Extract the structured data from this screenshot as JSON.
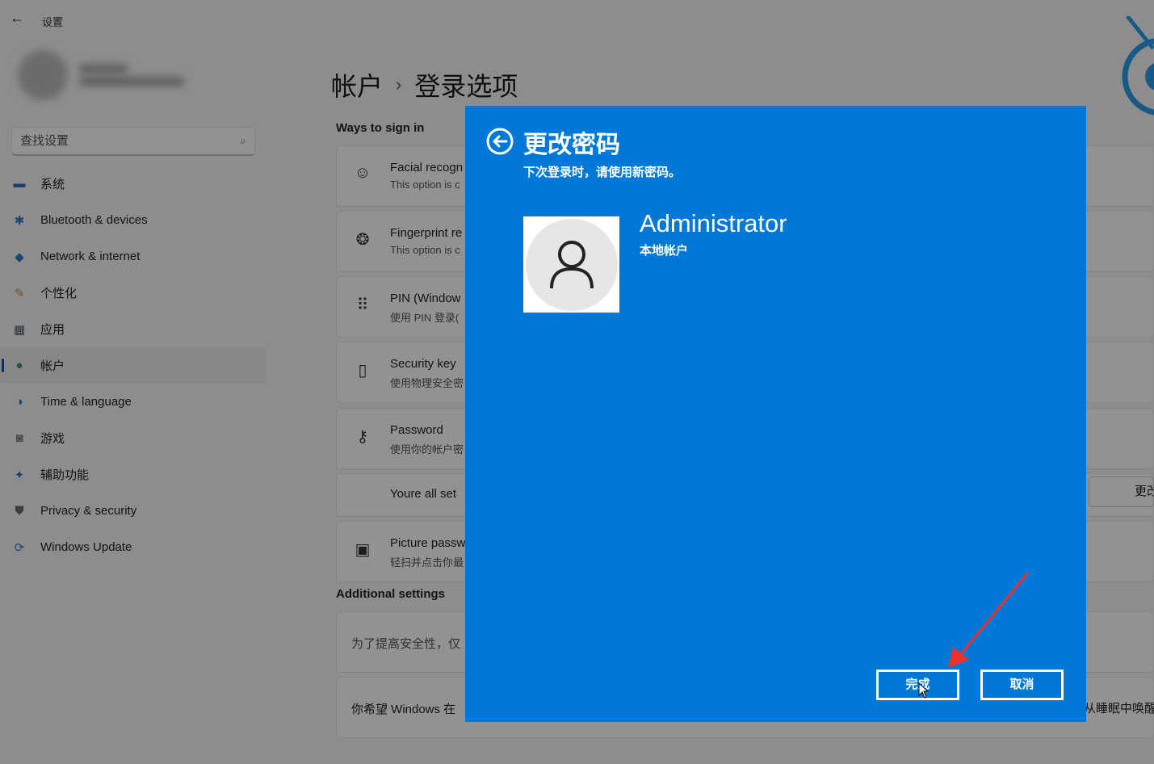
{
  "window": {
    "back_glyph": "←",
    "title": "设置"
  },
  "search": {
    "placeholder": "查找设置"
  },
  "nav": {
    "items": [
      {
        "label": "系统",
        "icon": "monitor-icon",
        "glyph": "▬",
        "color": "#2b79c2"
      },
      {
        "label": "Bluetooth & devices",
        "icon": "bluetooth-icon",
        "glyph": "✱",
        "color": "#2b79c2"
      },
      {
        "label": "Network & internet",
        "icon": "wifi-icon",
        "glyph": "◆",
        "color": "#2b79c2"
      },
      {
        "label": "个性化",
        "icon": "brush-icon",
        "glyph": "✎",
        "color": "#d08a3a"
      },
      {
        "label": "应用",
        "icon": "apps-icon",
        "glyph": "▦",
        "color": "#4b5a6b"
      },
      {
        "label": "帐户",
        "icon": "person-icon",
        "glyph": "●",
        "color": "#27a25b",
        "active": true
      },
      {
        "label": "Time & language",
        "icon": "globe-icon",
        "glyph": "◑",
        "color": "#2b79c2"
      },
      {
        "label": "游戏",
        "icon": "gamepad-icon",
        "glyph": "◙",
        "color": "#777777"
      },
      {
        "label": "辅助功能",
        "icon": "accessibility-icon",
        "glyph": "✦",
        "color": "#2b79c2"
      },
      {
        "label": "Privacy & security",
        "icon": "shield-icon",
        "glyph": "⛊",
        "color": "#6b6b6b"
      },
      {
        "label": "Windows Update",
        "icon": "update-icon",
        "glyph": "⟳",
        "color": "#2b79c2"
      }
    ]
  },
  "breadcrumb": {
    "parent": "帐户",
    "separator": "›",
    "current": "登录选项"
  },
  "sections": {
    "ways": "Ways to sign in",
    "additional": "Additional settings"
  },
  "cards": [
    {
      "title": "Facial recogn",
      "sub": "This option is c",
      "icon": "face-icon",
      "glyph": "☺"
    },
    {
      "title": "Fingerprint re",
      "sub": "This option is c",
      "icon": "fingerprint-icon",
      "glyph": "❂"
    },
    {
      "title": "PIN (Window",
      "sub": "使用 PIN 登录(",
      "icon": "keypad-icon",
      "glyph": "⠿"
    },
    {
      "title": "Security key",
      "sub": "使用物理安全密",
      "icon": "usb-key-icon",
      "glyph": "▯"
    },
    {
      "title": "Password",
      "sub": "使用你的帐户密",
      "icon": "key-icon",
      "glyph": "⚷"
    },
    {
      "title": "Youre all set",
      "sub": ""
    },
    {
      "title": "Picture passw",
      "sub": "轻扫并点击你最",
      "icon": "picture-icon",
      "glyph": "▣"
    }
  ],
  "additional_cards": [
    {
      "title": "为了提高安全性，仅"
    },
    {
      "title": "你希望 Windows 在"
    }
  ],
  "change_button": "更改",
  "right_text": "从睡眠中唤醒",
  "dialog": {
    "title": "更改密码",
    "subtitle": "下次登录时，请使用新密码。",
    "user_name": "Administrator",
    "user_type": "本地帐户",
    "done_label": "完成",
    "cancel_label": "取消",
    "bg_color": "#0078d7"
  }
}
